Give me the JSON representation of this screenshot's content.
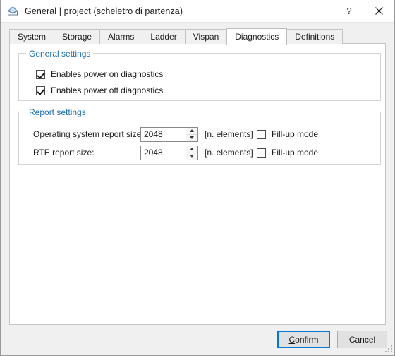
{
  "window": {
    "title": "General | project (scheletro di partenza)",
    "icon": "envelope-icon",
    "help_button": "?",
    "close_button": "✕"
  },
  "tabs": [
    {
      "label": "System",
      "active": false
    },
    {
      "label": "Storage",
      "active": false
    },
    {
      "label": "Alarms",
      "active": false
    },
    {
      "label": "Ladder",
      "active": false
    },
    {
      "label": "Vispan",
      "active": false
    },
    {
      "label": "Diagnostics",
      "active": true
    },
    {
      "label": "Definitions",
      "active": false
    }
  ],
  "general_settings": {
    "title": "General settings",
    "checkboxes": [
      {
        "label": "Enables power on diagnostics",
        "checked": true
      },
      {
        "label": "Enables power off diagnostics",
        "checked": true
      }
    ]
  },
  "report_settings": {
    "title": "Report settings",
    "rows": [
      {
        "label": "Operating system report size:",
        "value": "2048",
        "units": "[n. elements]",
        "fill_up_label": "Fill-up mode",
        "fill_up_checked": false
      },
      {
        "label": "RTE report size:",
        "value": "2048",
        "units": "[n. elements]",
        "fill_up_label": "Fill-up mode",
        "fill_up_checked": false
      }
    ]
  },
  "footer": {
    "confirm_accel": "C",
    "confirm_rest": "onfirm",
    "cancel_label": "Cancel"
  },
  "colors": {
    "group_title": "#1a6fb4",
    "focus_border": "#0078d7",
    "window_bg": "#f0f0f0",
    "panel_bg": "#ffffff"
  }
}
